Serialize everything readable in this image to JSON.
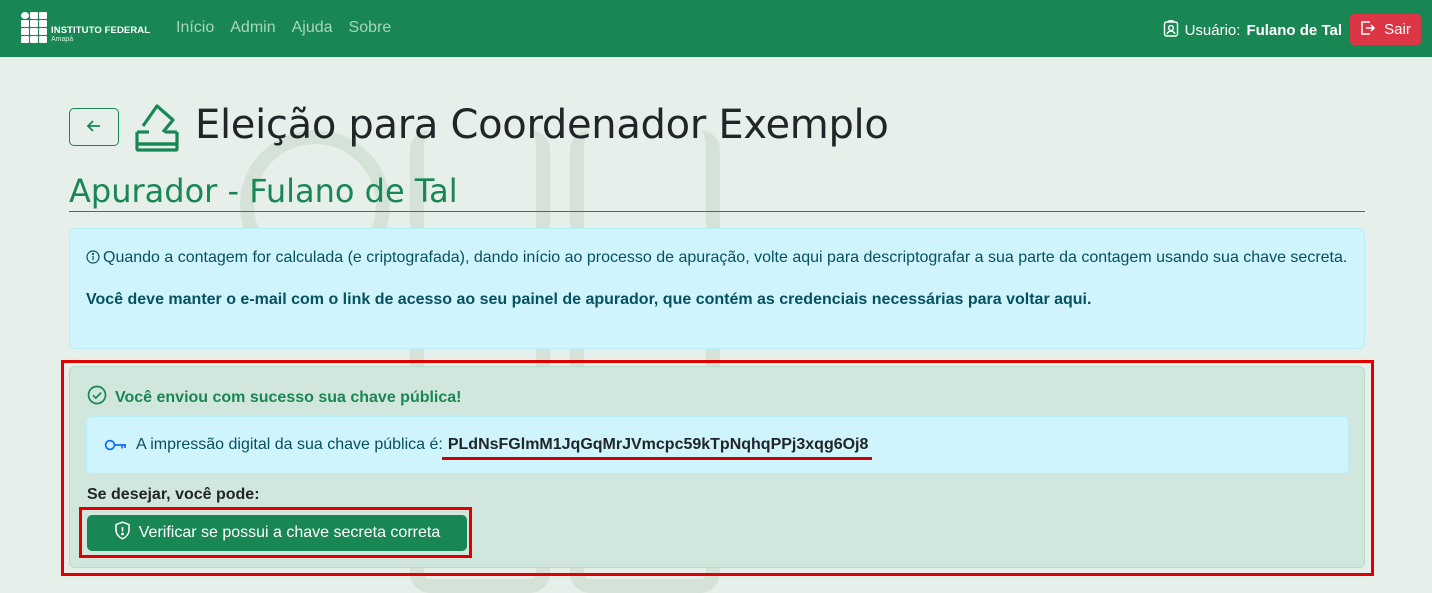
{
  "navbar": {
    "brand_name": "INSTITUTO FEDERAL",
    "brand_sub": "Amapá",
    "links": [
      "Início",
      "Admin",
      "Ajuda",
      "Sobre"
    ],
    "user_prefix": "Usuário:",
    "user_name": "Fulano de Tal",
    "logout_label": "Sair"
  },
  "header": {
    "title": "Eleição para Coordenador Exemplo",
    "subtitle": "Apurador - Fulano de Tal"
  },
  "info_alert": {
    "message": "Quando a contagem for calculada (e criptografada), dando início ao processo de apuração, volte aqui para descriptografar a sua parte da contagem usando sua chave secreta.",
    "warning": "Você deve manter o e-mail com o link de acesso ao seu painel de apurador, que contém as credenciais necessárias para voltar aqui."
  },
  "success_card": {
    "title": "Você enviou com sucesso sua chave pública!",
    "fingerprint_label": "A impressão digital da sua chave pública é:",
    "fingerprint_value": "PLdNsFGlmM1JqGqMrJVmcpc59kTpNqhqPPj3xqg6Oj8",
    "optional_label": "Se desejar, você pode:",
    "verify_button": "Verificar se possui a chave secreta correta"
  },
  "colors": {
    "primary": "#198754",
    "danger": "#dc3545",
    "info_bg": "#cff4fc",
    "success_bg": "#d1e7dd",
    "highlight": "#e00000"
  },
  "icons": [
    "arrow-left-icon",
    "ballot-box-icon",
    "info-circle-icon",
    "check-circle-icon",
    "key-icon",
    "shield-exclamation-icon",
    "person-badge-icon",
    "box-arrow-right-icon"
  ]
}
